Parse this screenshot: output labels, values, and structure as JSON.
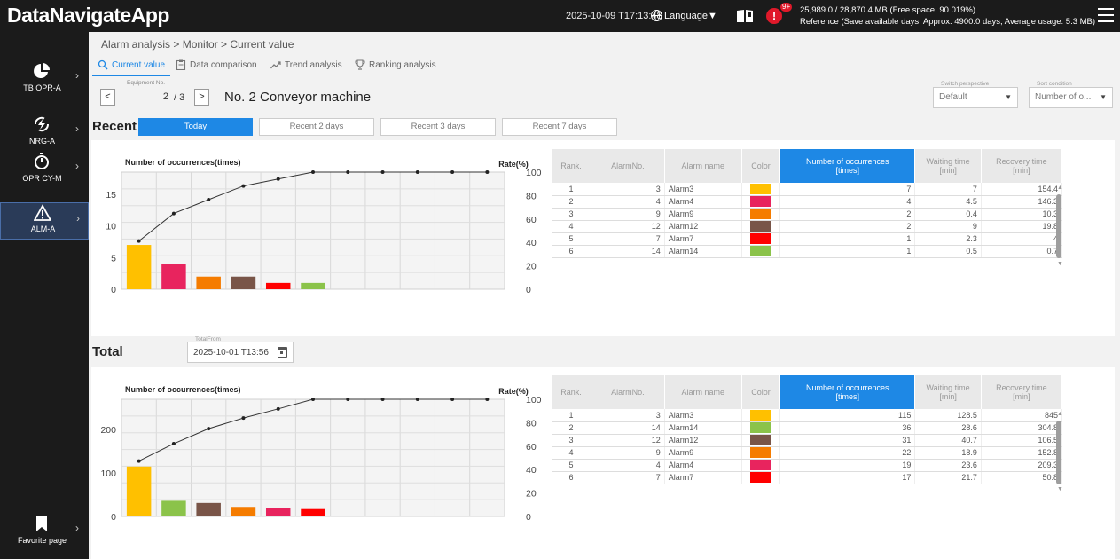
{
  "app": {
    "title": "DataNavigateApp",
    "datetime": "2025-10-09 T17:13:48",
    "language_label": "Language▼",
    "alert_badge": "9+",
    "storage_line1": "25,989.0 / 28,870.4 MB (Free space: 90.019%)",
    "storage_line2": "Reference (Save available days: Approx. 4900.0 days, Average usage: 5.3 MB)"
  },
  "sidebar": {
    "items": [
      {
        "label": "TB OPR-A",
        "icon": "pie-chart-icon"
      },
      {
        "label": "NRG-A",
        "icon": "lightning-icon"
      },
      {
        "label": "OPR CY-M",
        "icon": "stopwatch-icon"
      },
      {
        "label": "ALM-A",
        "icon": "warning-icon"
      }
    ],
    "favorite_label": "Favorite page"
  },
  "breadcrumb": "Alarm analysis > Monitor > Current value",
  "tabs": [
    {
      "label": "Current value",
      "icon": "magnifier-icon"
    },
    {
      "label": "Data comparison",
      "icon": "clipboard-icon"
    },
    {
      "label": "Trend analysis",
      "icon": "trend-icon"
    },
    {
      "label": "Ranking analysis",
      "icon": "trophy-icon"
    }
  ],
  "equipment": {
    "caption": "Equipment No.",
    "value": "2",
    "total": "/ 3",
    "name": "No. 2 Conveyor machine",
    "prev": "<",
    "next": ">"
  },
  "perspective": {
    "caption": "Switch perspective",
    "value": "Default"
  },
  "sort": {
    "caption": "Sort condition",
    "value": "Number of o..."
  },
  "recent": {
    "title": "Recent",
    "periods": [
      "Today",
      "Recent 2 days",
      "Recent 3 days",
      "Recent 7 days"
    ]
  },
  "total": {
    "title": "Total",
    "from_caption": "TotalFrom",
    "from_value": "2025-10-01 T13:56"
  },
  "table_headers": {
    "rank": "Rank.",
    "alarm_no": "AlarmNo.",
    "alarm_name": "Alarm name",
    "color": "Color",
    "occurrences": "Number of occurrences",
    "occurrences_unit": "[times]",
    "waiting": "Waiting time",
    "waiting_unit": "[min]",
    "recovery": "Recovery time",
    "recovery_unit": "[min]"
  },
  "recent_rows": [
    {
      "rank": "1",
      "no": "3",
      "name": "Alarm3",
      "color": "#FFC000",
      "occ": "7",
      "wait": "7",
      "rec": "154.4"
    },
    {
      "rank": "2",
      "no": "4",
      "name": "Alarm4",
      "color": "#E8245E",
      "occ": "4",
      "wait": "4.5",
      "rec": "146.3"
    },
    {
      "rank": "3",
      "no": "9",
      "name": "Alarm9",
      "color": "#F57C00",
      "occ": "2",
      "wait": "0.4",
      "rec": "10.3"
    },
    {
      "rank": "4",
      "no": "12",
      "name": "Alarm12",
      "color": "#795548",
      "occ": "2",
      "wait": "9",
      "rec": "19.8"
    },
    {
      "rank": "5",
      "no": "7",
      "name": "Alarm7",
      "color": "#FF0000",
      "occ": "1",
      "wait": "2.3",
      "rec": "4"
    },
    {
      "rank": "6",
      "no": "14",
      "name": "Alarm14",
      "color": "#8BC34A",
      "occ": "1",
      "wait": "0.5",
      "rec": "0.7"
    }
  ],
  "total_rows": [
    {
      "rank": "1",
      "no": "3",
      "name": "Alarm3",
      "color": "#FFC000",
      "occ": "115",
      "wait": "128.5",
      "rec": "845"
    },
    {
      "rank": "2",
      "no": "14",
      "name": "Alarm14",
      "color": "#8BC34A",
      "occ": "36",
      "wait": "28.6",
      "rec": "304.8"
    },
    {
      "rank": "3",
      "no": "12",
      "name": "Alarm12",
      "color": "#795548",
      "occ": "31",
      "wait": "40.7",
      "rec": "106.5"
    },
    {
      "rank": "4",
      "no": "9",
      "name": "Alarm9",
      "color": "#F57C00",
      "occ": "22",
      "wait": "18.9",
      "rec": "152.8"
    },
    {
      "rank": "5",
      "no": "4",
      "name": "Alarm4",
      "color": "#E8245E",
      "occ": "19",
      "wait": "23.6",
      "rec": "209.3"
    },
    {
      "rank": "6",
      "no": "7",
      "name": "Alarm7",
      "color": "#FF0000",
      "occ": "17",
      "wait": "21.7",
      "rec": "50.8"
    }
  ],
  "chart_data": [
    {
      "type": "bar",
      "title": "Number of occurrences(times)",
      "y2label": "Rate(%)",
      "categories": [
        "Alarm3",
        "Alarm4",
        "Alarm9",
        "Alarm12",
        "Alarm7",
        "Alarm14"
      ],
      "values": [
        7,
        4,
        2,
        2,
        1,
        1
      ],
      "colors": [
        "#FFC000",
        "#E8245E",
        "#F57C00",
        "#795548",
        "#FF0000",
        "#8BC34A"
      ],
      "ylim": [
        0,
        18.5
      ],
      "yticks": [
        0,
        5,
        10,
        15
      ],
      "y2lim": [
        0,
        100
      ],
      "y2ticks": [
        0,
        20,
        40,
        60,
        80,
        100
      ],
      "cumulative_rate": [
        41.2,
        64.7,
        76.5,
        88.2,
        94.1,
        100,
        100,
        100,
        100,
        100,
        100
      ],
      "grid": true
    },
    {
      "type": "bar",
      "title": "Number of occurrences(times)",
      "y2label": "Rate(%)",
      "categories": [
        "Alarm3",
        "Alarm14",
        "Alarm12",
        "Alarm9",
        "Alarm4",
        "Alarm7"
      ],
      "values": [
        115,
        36,
        31,
        22,
        19,
        17
      ],
      "colors": [
        "#FFC000",
        "#8BC34A",
        "#795548",
        "#F57C00",
        "#E8245E",
        "#FF0000"
      ],
      "ylim": [
        0,
        270
      ],
      "yticks": [
        0,
        100,
        200
      ],
      "y2lim": [
        0,
        100
      ],
      "y2ticks": [
        0,
        20,
        40,
        60,
        80,
        100
      ],
      "cumulative_rate": [
        47.3,
        62.1,
        74.9,
        84.0,
        91.8,
        100,
        100,
        100,
        100,
        100,
        100
      ],
      "grid": true
    }
  ]
}
